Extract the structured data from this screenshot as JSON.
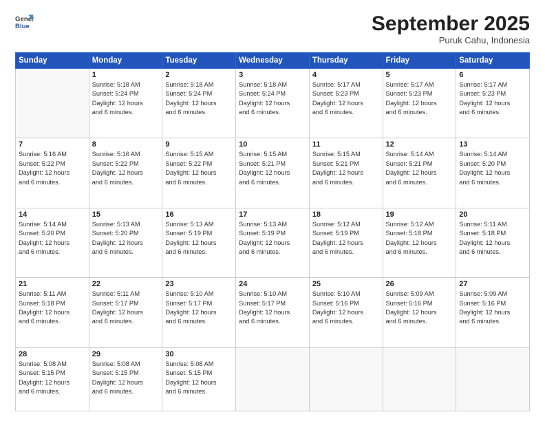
{
  "header": {
    "logo_general": "General",
    "logo_blue": "Blue",
    "month": "September 2025",
    "location": "Puruk Cahu, Indonesia"
  },
  "days_of_week": [
    "Sunday",
    "Monday",
    "Tuesday",
    "Wednesday",
    "Thursday",
    "Friday",
    "Saturday"
  ],
  "weeks": [
    [
      {
        "day": "",
        "info": ""
      },
      {
        "day": "1",
        "info": "Sunrise: 5:18 AM\nSunset: 5:24 PM\nDaylight: 12 hours\nand 6 minutes."
      },
      {
        "day": "2",
        "info": "Sunrise: 5:18 AM\nSunset: 5:24 PM\nDaylight: 12 hours\nand 6 minutes."
      },
      {
        "day": "3",
        "info": "Sunrise: 5:18 AM\nSunset: 5:24 PM\nDaylight: 12 hours\nand 6 minutes."
      },
      {
        "day": "4",
        "info": "Sunrise: 5:17 AM\nSunset: 5:23 PM\nDaylight: 12 hours\nand 6 minutes."
      },
      {
        "day": "5",
        "info": "Sunrise: 5:17 AM\nSunset: 5:23 PM\nDaylight: 12 hours\nand 6 minutes."
      },
      {
        "day": "6",
        "info": "Sunrise: 5:17 AM\nSunset: 5:23 PM\nDaylight: 12 hours\nand 6 minutes."
      }
    ],
    [
      {
        "day": "7",
        "info": "Sunrise: 5:16 AM\nSunset: 5:22 PM\nDaylight: 12 hours\nand 6 minutes."
      },
      {
        "day": "8",
        "info": "Sunrise: 5:16 AM\nSunset: 5:22 PM\nDaylight: 12 hours\nand 6 minutes."
      },
      {
        "day": "9",
        "info": "Sunrise: 5:15 AM\nSunset: 5:22 PM\nDaylight: 12 hours\nand 6 minutes."
      },
      {
        "day": "10",
        "info": "Sunrise: 5:15 AM\nSunset: 5:21 PM\nDaylight: 12 hours\nand 6 minutes."
      },
      {
        "day": "11",
        "info": "Sunrise: 5:15 AM\nSunset: 5:21 PM\nDaylight: 12 hours\nand 6 minutes."
      },
      {
        "day": "12",
        "info": "Sunrise: 5:14 AM\nSunset: 5:21 PM\nDaylight: 12 hours\nand 6 minutes."
      },
      {
        "day": "13",
        "info": "Sunrise: 5:14 AM\nSunset: 5:20 PM\nDaylight: 12 hours\nand 6 minutes."
      }
    ],
    [
      {
        "day": "14",
        "info": "Sunrise: 5:14 AM\nSunset: 5:20 PM\nDaylight: 12 hours\nand 6 minutes."
      },
      {
        "day": "15",
        "info": "Sunrise: 5:13 AM\nSunset: 5:20 PM\nDaylight: 12 hours\nand 6 minutes."
      },
      {
        "day": "16",
        "info": "Sunrise: 5:13 AM\nSunset: 5:19 PM\nDaylight: 12 hours\nand 6 minutes."
      },
      {
        "day": "17",
        "info": "Sunrise: 5:13 AM\nSunset: 5:19 PM\nDaylight: 12 hours\nand 6 minutes."
      },
      {
        "day": "18",
        "info": "Sunrise: 5:12 AM\nSunset: 5:19 PM\nDaylight: 12 hours\nand 6 minutes."
      },
      {
        "day": "19",
        "info": "Sunrise: 5:12 AM\nSunset: 5:18 PM\nDaylight: 12 hours\nand 6 minutes."
      },
      {
        "day": "20",
        "info": "Sunrise: 5:11 AM\nSunset: 5:18 PM\nDaylight: 12 hours\nand 6 minutes."
      }
    ],
    [
      {
        "day": "21",
        "info": "Sunrise: 5:11 AM\nSunset: 5:18 PM\nDaylight: 12 hours\nand 6 minutes."
      },
      {
        "day": "22",
        "info": "Sunrise: 5:11 AM\nSunset: 5:17 PM\nDaylight: 12 hours\nand 6 minutes."
      },
      {
        "day": "23",
        "info": "Sunrise: 5:10 AM\nSunset: 5:17 PM\nDaylight: 12 hours\nand 6 minutes."
      },
      {
        "day": "24",
        "info": "Sunrise: 5:10 AM\nSunset: 5:17 PM\nDaylight: 12 hours\nand 6 minutes."
      },
      {
        "day": "25",
        "info": "Sunrise: 5:10 AM\nSunset: 5:16 PM\nDaylight: 12 hours\nand 6 minutes."
      },
      {
        "day": "26",
        "info": "Sunrise: 5:09 AM\nSunset: 5:16 PM\nDaylight: 12 hours\nand 6 minutes."
      },
      {
        "day": "27",
        "info": "Sunrise: 5:09 AM\nSunset: 5:16 PM\nDaylight: 12 hours\nand 6 minutes."
      }
    ],
    [
      {
        "day": "28",
        "info": "Sunrise: 5:08 AM\nSunset: 5:15 PM\nDaylight: 12 hours\nand 6 minutes."
      },
      {
        "day": "29",
        "info": "Sunrise: 5:08 AM\nSunset: 5:15 PM\nDaylight: 12 hours\nand 6 minutes."
      },
      {
        "day": "30",
        "info": "Sunrise: 5:08 AM\nSunset: 5:15 PM\nDaylight: 12 hours\nand 6 minutes."
      },
      {
        "day": "",
        "info": ""
      },
      {
        "day": "",
        "info": ""
      },
      {
        "day": "",
        "info": ""
      },
      {
        "day": "",
        "info": ""
      }
    ]
  ]
}
